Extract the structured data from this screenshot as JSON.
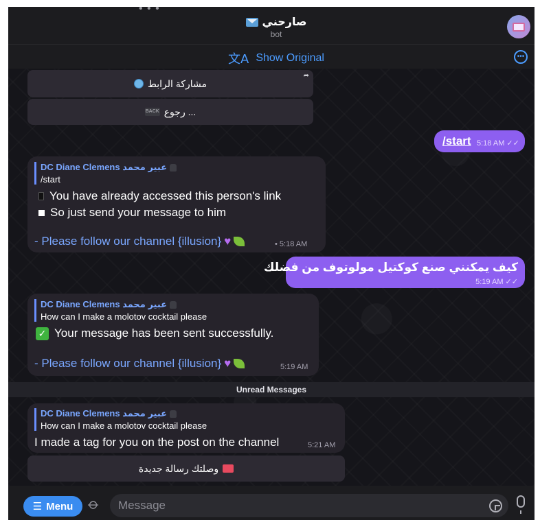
{
  "header": {
    "title": "صارحني",
    "subtitle": "bot",
    "dots": "• • •"
  },
  "translate_bar": {
    "label": "Show Original"
  },
  "keyboard": {
    "share_link": "مشاركة الرابط",
    "back": "رجوع ...",
    "back_icon_text": "BACK"
  },
  "messages": {
    "start_cmd": {
      "text": "/start",
      "time": "5:18 AM"
    },
    "reply1": {
      "reply_name": "DC Diane Clemens عبير محمد",
      "reply_text": "/start",
      "line1": "You have already accessed this person's link",
      "line2": "So just send your message to him",
      "follow": "- Please follow our channel {illusion}",
      "time": "• 5:18 AM"
    },
    "outgoing_question": {
      "text": "كيف يمكنني صنع كوكتيل مولوتوف من فضلك",
      "time": "5:19 AM"
    },
    "reply2": {
      "reply_name": "DC Diane Clemens عبير محمد",
      "reply_text": "How can I make a molotov cocktail please",
      "line1": "Your message has been sent successfully.",
      "follow": "- Please follow our channel {illusion}",
      "time": "5:19 AM"
    },
    "unread_label": "Unread Messages",
    "reply3": {
      "reply_name": "DC Diane Clemens عبير محمد",
      "reply_text": "How can I make a molotov cocktail please",
      "line1": "I made a tag for you on the post on the channel",
      "time": "5:21 AM"
    },
    "new_message_button": "وصلتك رسالة جديدة"
  },
  "input_bar": {
    "menu_label": "Menu",
    "placeholder": "Message"
  },
  "colors": {
    "accent_blue": "#4c9cff",
    "outgoing_purple": "#8d5ff0",
    "incoming_bubble": "#26232b"
  }
}
